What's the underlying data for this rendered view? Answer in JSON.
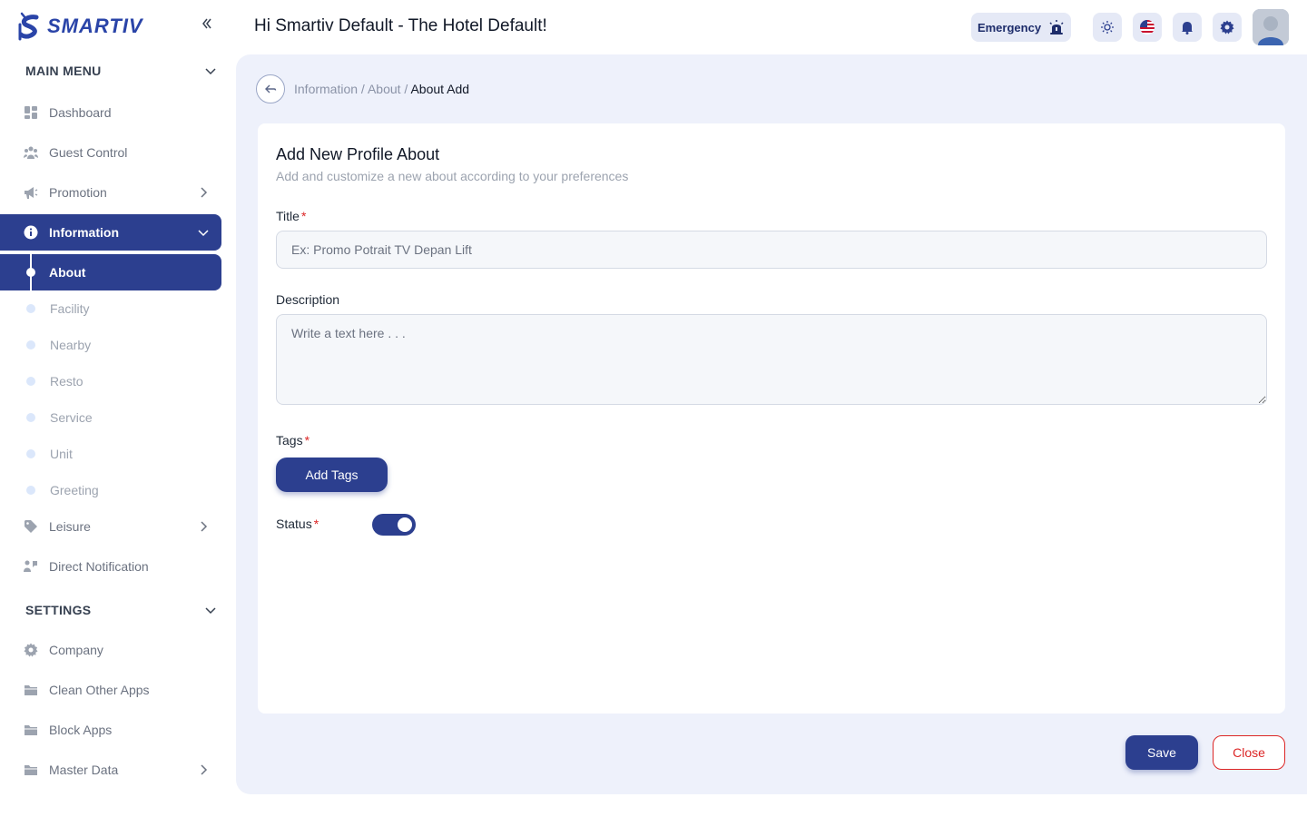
{
  "app": {
    "brand": "SMARTIV"
  },
  "header": {
    "greeting": "Hi Smartiv Default - The Hotel Default!",
    "emergency_label": "Emergency"
  },
  "sidebar": {
    "main_menu_title": "MAIN MENU",
    "settings_title": "SETTINGS",
    "items": [
      {
        "label": "Dashboard",
        "icon": "dashboard-icon"
      },
      {
        "label": "Guest Control",
        "icon": "users-icon"
      },
      {
        "label": "Promotion",
        "icon": "megaphone-icon"
      },
      {
        "label": "Information",
        "icon": "info-icon"
      },
      {
        "label": "Leisure",
        "icon": "tag-icon"
      },
      {
        "label": "Direct Notification",
        "icon": "notification-icon"
      }
    ],
    "information_sub": [
      "About",
      "Facility",
      "Nearby",
      "Resto",
      "Service",
      "Unit",
      "Greeting"
    ],
    "settings_items": [
      {
        "label": "Company",
        "icon": "gear-icon"
      },
      {
        "label": "Clean Other Apps",
        "icon": "folder-icon"
      },
      {
        "label": "Block Apps",
        "icon": "folder-icon"
      },
      {
        "label": "Master Data",
        "icon": "folder-icon"
      }
    ]
  },
  "breadcrumb": {
    "part1": "Information /",
    "part2": "About /",
    "current": "About Add"
  },
  "form": {
    "title": "Add New Profile About",
    "subtitle": "Add and customize a new about according to your preferences",
    "title_label": "Title",
    "title_placeholder": "Ex: Promo Potrait TV Depan Lift",
    "description_label": "Description",
    "description_placeholder": "Write a text here . . .",
    "tags_label": "Tags",
    "add_tags_label": "Add Tags",
    "status_label": "Status",
    "required_mark": "*",
    "status_on": true
  },
  "actions": {
    "save_label": "Save",
    "close_label": "Close"
  },
  "colors": {
    "primary": "#2c3f8f",
    "danger": "#dc2626",
    "main_bg": "#eef1fb"
  }
}
